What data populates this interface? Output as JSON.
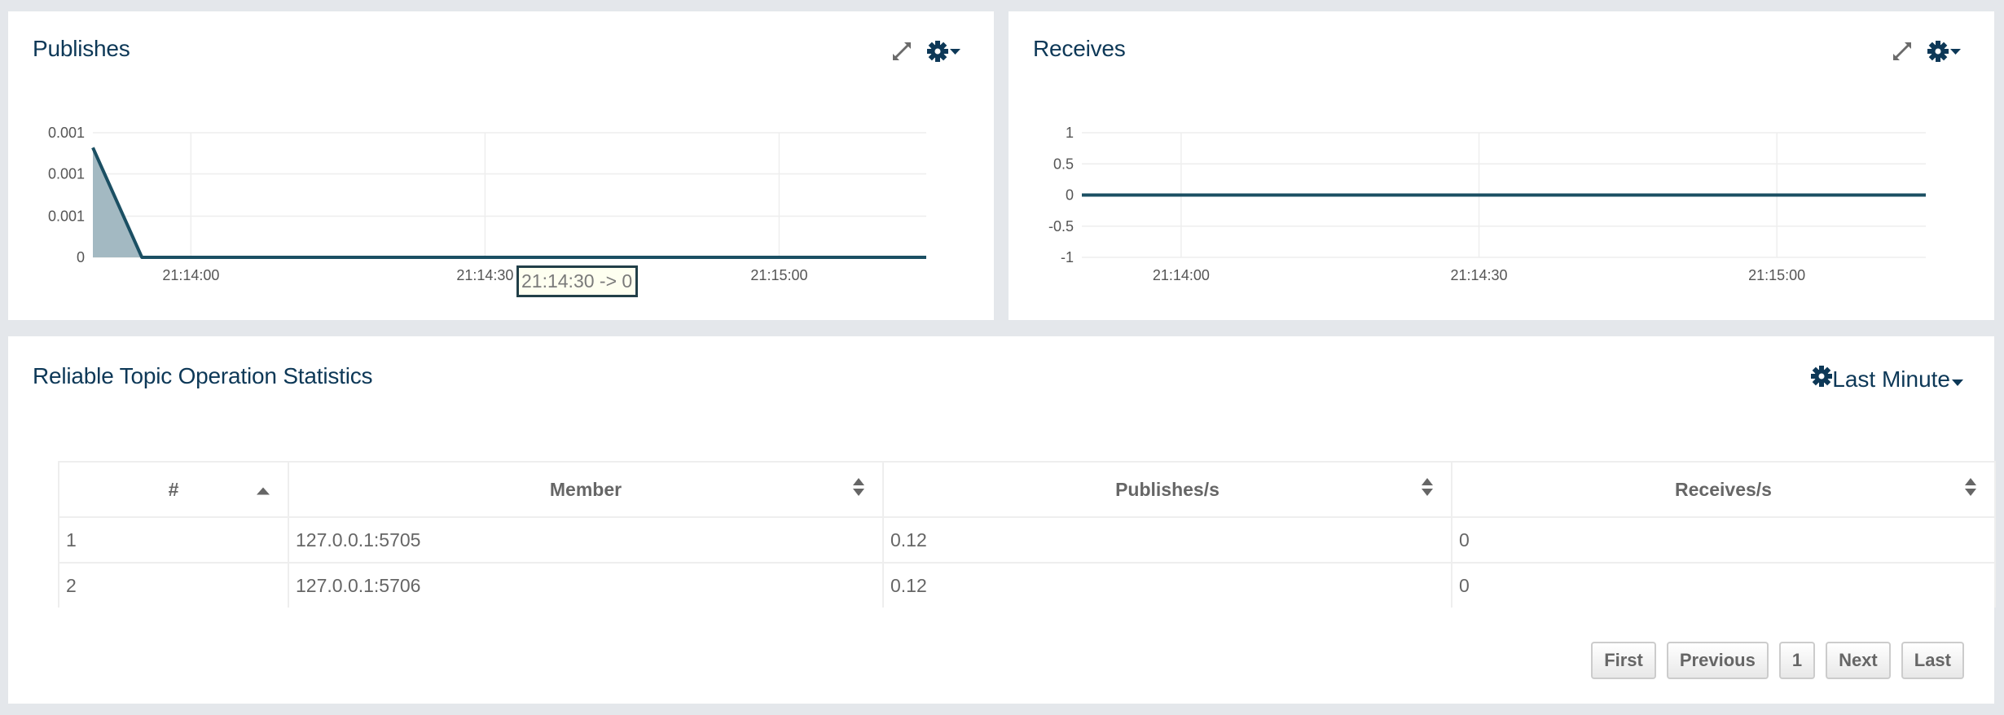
{
  "publishes_panel": {
    "title": "Publishes",
    "expand_icon": "expand-arrows-icon",
    "settings_icon": "gear-dropdown-icon",
    "tooltip": "21:14:30 -> 0"
  },
  "receives_panel": {
    "title": "Receives",
    "expand_icon": "expand-arrows-icon",
    "settings_icon": "gear-dropdown-icon"
  },
  "stats_panel": {
    "title": "Reliable Topic Operation Statistics",
    "range_label": "Last Minute",
    "columns": [
      "#",
      "Member",
      "Publishes/s",
      "Receives/s"
    ],
    "sort_state": [
      "ascending",
      "unsorted",
      "unsorted",
      "unsorted"
    ],
    "rows": [
      [
        "1",
        "127.0.0.1:5705",
        "0.12",
        "0"
      ],
      [
        "2",
        "127.0.0.1:5706",
        "0.12",
        "0"
      ]
    ],
    "pagination": {
      "first": "First",
      "previous": "Previous",
      "current_page": "1",
      "next": "Next",
      "last": "Last"
    }
  },
  "colors": {
    "series_line": "#1b4f63",
    "series_fill": "#a3b9c2",
    "title": "#0d3857"
  },
  "chart_data": [
    {
      "type": "area",
      "title": "Publishes",
      "xlabel": "",
      "ylabel": "",
      "x": [
        "21:13:50",
        "21:13:55",
        "21:14:00",
        "21:14:05",
        "21:14:10",
        "21:14:15",
        "21:14:20",
        "21:14:25",
        "21:14:30",
        "21:14:35",
        "21:14:40",
        "21:14:45",
        "21:14:50",
        "21:14:55",
        "21:15:00",
        "21:15:05",
        "21:15:10",
        "21:15:15"
      ],
      "series": [
        {
          "name": "Publishes",
          "values": [
            0.00088,
            0,
            0,
            0,
            0,
            0,
            0,
            0,
            0,
            0,
            0,
            0,
            0,
            0,
            0,
            0,
            0,
            0
          ]
        }
      ],
      "xlim": [
        "21:13:50",
        "21:15:15"
      ],
      "ylim": [
        0,
        0.001
      ],
      "yticks": [
        0,
        0.00033,
        0.00067,
        0.001
      ],
      "ytick_labels": [
        "0",
        "0.001",
        "0.001",
        "0.001"
      ],
      "xticks": [
        "21:14:00",
        "21:14:30",
        "21:15:00"
      ],
      "grid": true,
      "legend": "none",
      "tooltip": "21:14:30 -> 0"
    },
    {
      "type": "line",
      "title": "Receives",
      "xlabel": "",
      "ylabel": "",
      "x": [
        "21:13:50",
        "21:13:55",
        "21:14:00",
        "21:14:05",
        "21:14:10",
        "21:14:15",
        "21:14:20",
        "21:14:25",
        "21:14:30",
        "21:14:35",
        "21:14:40",
        "21:14:45",
        "21:14:50",
        "21:14:55",
        "21:15:00",
        "21:15:05",
        "21:15:10",
        "21:15:15"
      ],
      "series": [
        {
          "name": "Receives",
          "values": [
            0,
            0,
            0,
            0,
            0,
            0,
            0,
            0,
            0,
            0,
            0,
            0,
            0,
            0,
            0,
            0,
            0,
            0
          ]
        }
      ],
      "xlim": [
        "21:13:50",
        "21:15:15"
      ],
      "ylim": [
        -1,
        1
      ],
      "yticks": [
        -1,
        -0.5,
        0,
        0.5,
        1
      ],
      "ytick_labels": [
        "-1",
        "-0.5",
        "0",
        "0.5",
        "1"
      ],
      "xticks": [
        "21:14:00",
        "21:14:30",
        "21:15:00"
      ],
      "grid": true,
      "legend": "none"
    }
  ]
}
